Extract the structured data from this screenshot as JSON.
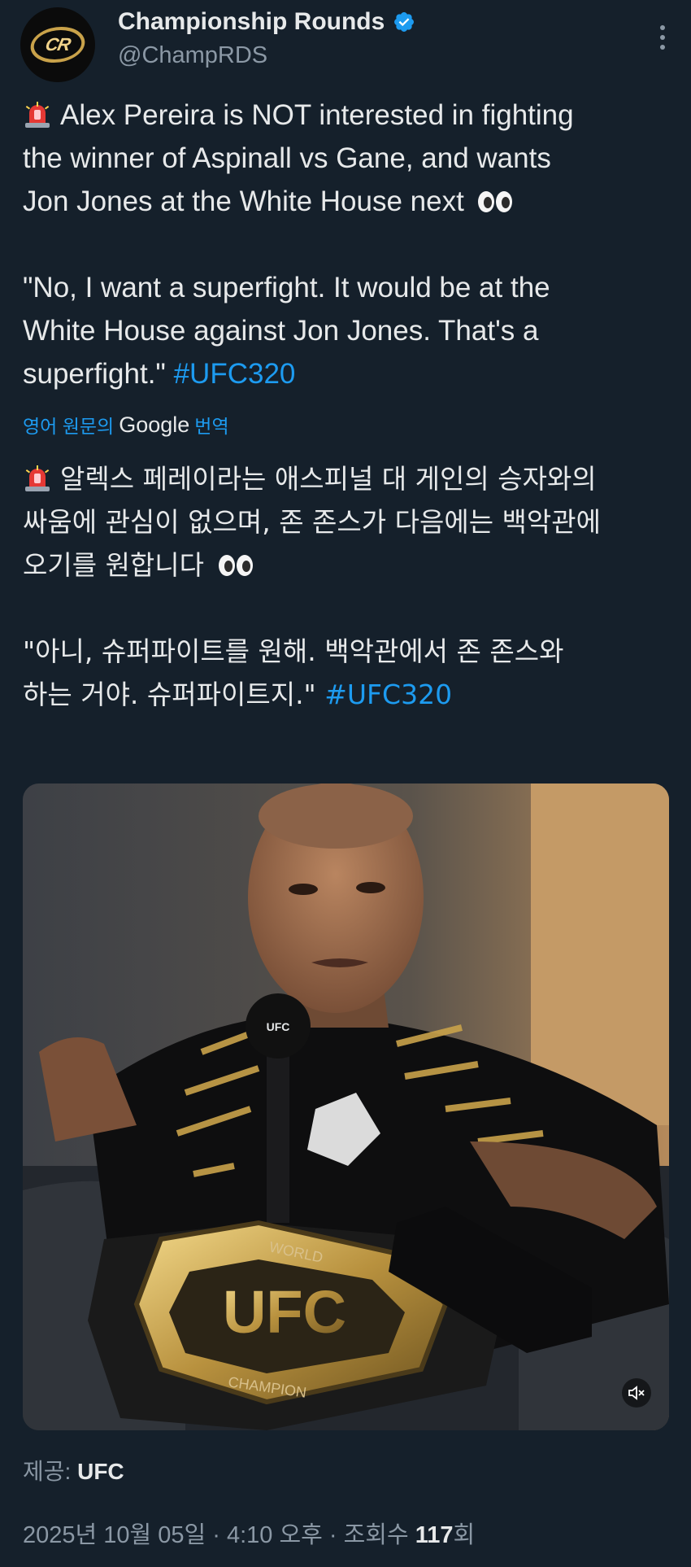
{
  "account": {
    "name": "Championship Rounds",
    "handle": "@ChampRDS",
    "avatar_text": "CR",
    "verified": true
  },
  "tweet": {
    "en_line1": "Alex Pereira is NOT interested in fighting",
    "en_line2": "the winner of Aspinall vs Gane, and wants",
    "en_line3": "Jon Jones at the White House next",
    "quote_line1": "\"No, I want a superfight. It would be at the",
    "quote_line2": "White House against Jon Jones. That's a",
    "quote_line3": "superfight.\"",
    "hashtag": "#UFC320"
  },
  "translation": {
    "prefix": "영어 원문의",
    "provider": "Google",
    "suffix": "번역",
    "ko_line1": "알렉스 페레이라는 애스피널 대 게인의 승자와의",
    "ko_line2": "싸움에 관심이 없으며, 존 존스가 다음에는 백악관에",
    "ko_line3": "오기를 원합니다",
    "ko_quote1": "\"아니, 슈퍼파이트를 원해. 백악관에서 존 존스와",
    "ko_quote2": "하는 거야. 슈퍼파이트지.\"",
    "hashtag": "#UFC320"
  },
  "media": {
    "belt_text_top": "WORLD",
    "belt_text_center": "UFC",
    "belt_text_bottom": "CHAMPION",
    "mic_text": "UFC"
  },
  "credit": {
    "label": "제공:",
    "source": "UFC"
  },
  "meta": {
    "date": "2025년 10월 05일",
    "time": "4:10 오후",
    "views_label": "조회수",
    "views_count": "117",
    "views_suffix": "회"
  },
  "colors": {
    "background": "#15202b",
    "link": "#1d9bf0",
    "secondary_text": "#8b98a5"
  }
}
